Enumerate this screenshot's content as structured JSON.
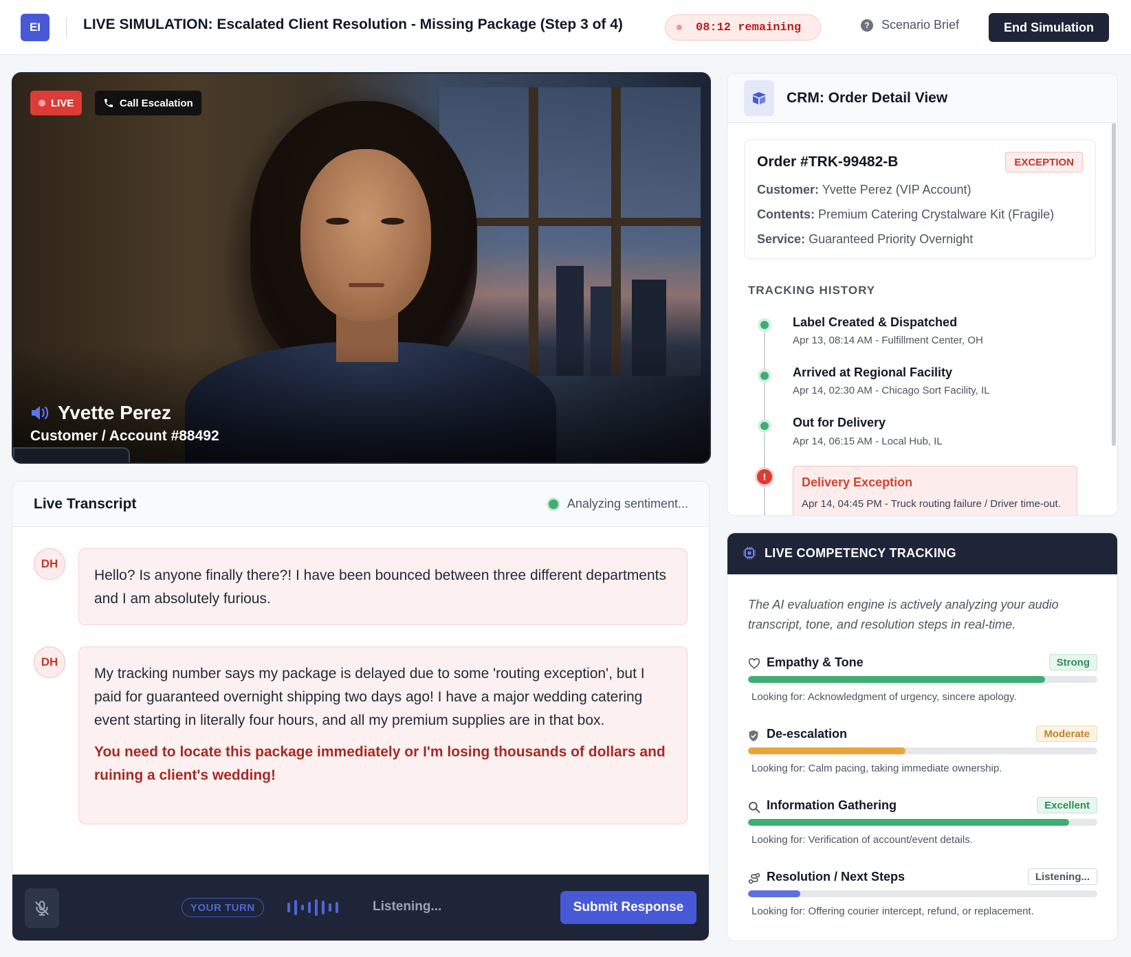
{
  "header": {
    "logo": "EI",
    "title": "LIVE SIMULATION: Escalated Client Resolution - Missing Package (Step 3 of 4)",
    "timer": "08:12 remaining",
    "brief_label": "Scenario Brief",
    "end_label": "End Simulation"
  },
  "video": {
    "live_label": "LIVE",
    "call_label": "Call Escalation",
    "caller_name": "Yvette Perez",
    "caller_sub": "Customer / Account #88492"
  },
  "transcript": {
    "title": "Live Transcript",
    "status": "Analyzing sentiment...",
    "messages": [
      {
        "initials": "DH",
        "text": "Hello? Is anyone finally there?! I have been bounced between three different departments and I am absolutely furious.",
        "emphasis": ""
      },
      {
        "initials": "DH",
        "text": "My tracking number says my package is delayed due to some 'routing exception', but I paid for guaranteed overnight shipping two days ago! I have a major wedding catering event starting in literally four hours, and all my premium supplies are in that box.",
        "emphasis": "You need to locate this package immediately or I'm losing thousands of dollars and ruining a client's wedding!"
      }
    ],
    "controls": {
      "your_turn": "YOUR TURN",
      "listening": "Listening...",
      "submit": "Submit Response"
    }
  },
  "crm": {
    "title": "CRM: Order Detail View",
    "order": {
      "id": "Order #TRK-99482-B",
      "status": "EXCEPTION",
      "customer_label": "Customer:",
      "customer": "Yvette Perez (VIP Account)",
      "contents_label": "Contents:",
      "contents": "Premium Catering Crystalware Kit (Fragile)",
      "service_label": "Service:",
      "service": "Guaranteed Priority Overnight"
    },
    "tracking_label": "TRACKING HISTORY",
    "tracking": [
      {
        "title": "Label Created & Dispatched",
        "detail": "Apr 13, 08:14 AM - Fulfillment Center, OH"
      },
      {
        "title": "Arrived at Regional Facility",
        "detail": "Apr 14, 02:30 AM - Chicago Sort Facility, IL"
      },
      {
        "title": "Out for Delivery",
        "detail": "Apr 14, 06:15 AM - Local Hub, IL"
      },
      {
        "title": "Delivery Exception",
        "detail": "Apr 14, 04:45 PM - Truck routing failure / Driver time-out. Package returned to Local Hub."
      }
    ]
  },
  "competency": {
    "title": "LIVE COMPETENCY TRACKING",
    "description": "The AI evaluation engine is actively analyzing your audio transcript, tone, and resolution steps in real-time.",
    "metrics": [
      {
        "name": "Empathy & Tone",
        "rating": "Strong",
        "level": 0.85,
        "looking_for": "Looking for: Acknowledgment of urgency, sincere apology.",
        "color": "#3fae74",
        "icon": "heart-icon"
      },
      {
        "name": "De-escalation",
        "rating": "Moderate",
        "level": 0.45,
        "looking_for": "Looking for: Calm pacing, taking immediate ownership.",
        "color": "#e8a53a",
        "icon": "shield-icon"
      },
      {
        "name": "Information Gathering",
        "rating": "Excellent",
        "level": 0.92,
        "looking_for": "Looking for: Verification of account/event details.",
        "color": "#3fae74",
        "icon": "search-icon"
      },
      {
        "name": "Resolution / Next Steps",
        "rating": "Listening...",
        "level": 0.15,
        "looking_for": "Looking for: Offering courier intercept, refund, or replacement.",
        "color": "#5f6fe0",
        "icon": "route-icon"
      }
    ]
  }
}
